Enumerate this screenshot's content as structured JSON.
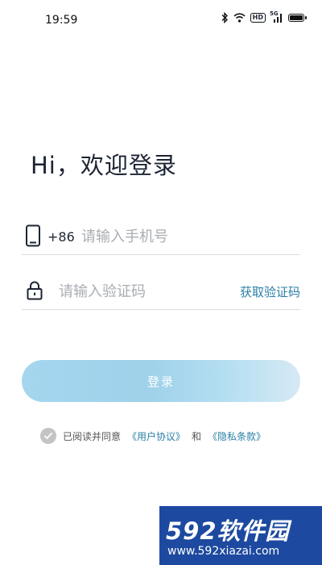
{
  "status_bar": {
    "time": "19:59",
    "icons": [
      "bluetooth-icon",
      "wifi-icon",
      "hd-icon",
      "signal-5g-icon",
      "battery-icon"
    ],
    "hd_label": "HD",
    "signal_label": "5G"
  },
  "login": {
    "greeting": "Hi，欢迎登录",
    "country_code": "+86",
    "phone_placeholder": "请输入手机号",
    "code_placeholder": "请输入验证码",
    "get_code_label": "获取验证码",
    "submit_label": "登录",
    "submit_gradient": [
      "#a4d7ef",
      "#d6e9f4"
    ]
  },
  "agreement": {
    "checked": true,
    "prefix": "已阅读并同意",
    "user_agreement": "《用户协议》",
    "conjunction": "和",
    "privacy_policy": "《隐私条款》"
  },
  "watermark": {
    "brand": "592软件园",
    "url": "www.592xiazai.com"
  },
  "colors": {
    "link": "#2a7fa6",
    "placeholder": "#a9adb3",
    "divider": "#d9dde3",
    "watermark_bg": "#1d4aa0"
  }
}
